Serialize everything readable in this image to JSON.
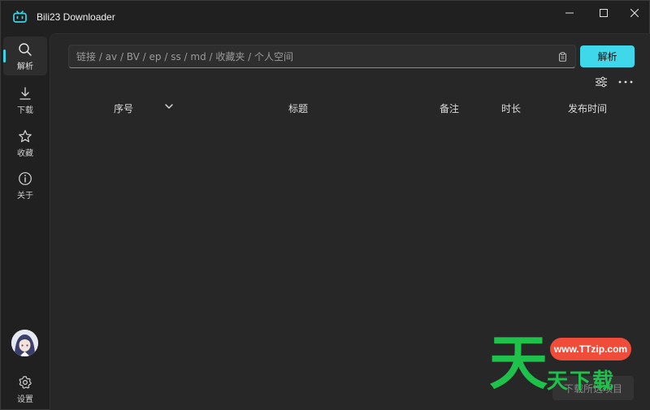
{
  "app": {
    "title": "Bili23 Downloader"
  },
  "window_controls": {
    "minimize_icon": "minimize-icon",
    "maximize_icon": "maximize-icon",
    "close_icon": "close-icon"
  },
  "sidebar": {
    "items": [
      {
        "label": "解析",
        "icon": "search-icon",
        "active": true
      },
      {
        "label": "下载",
        "icon": "download-icon",
        "active": false
      },
      {
        "label": "收藏",
        "icon": "star-icon",
        "active": false
      },
      {
        "label": "关于",
        "icon": "info-icon",
        "active": false
      }
    ],
    "settings_label": "设置",
    "settings_icon": "gear-icon"
  },
  "search": {
    "placeholder": "链接 / av / BV / ep / ss / md / 收藏夹 / 个人空间",
    "value": ""
  },
  "parse_button": {
    "label": "解析"
  },
  "table": {
    "columns": [
      "序号",
      "标题",
      "备注",
      "时长",
      "发布时间"
    ],
    "rows": []
  },
  "download_selected": {
    "label": "下载所选项目"
  },
  "watermark": {
    "big": "天",
    "badge": "www.TTzip.com",
    "small": "天下载"
  },
  "colors": {
    "accent": "#3fd8ea",
    "background": "#202020",
    "panel": "#272727",
    "watermark_green": "#1ec24a",
    "watermark_red": "#f04c3a"
  }
}
